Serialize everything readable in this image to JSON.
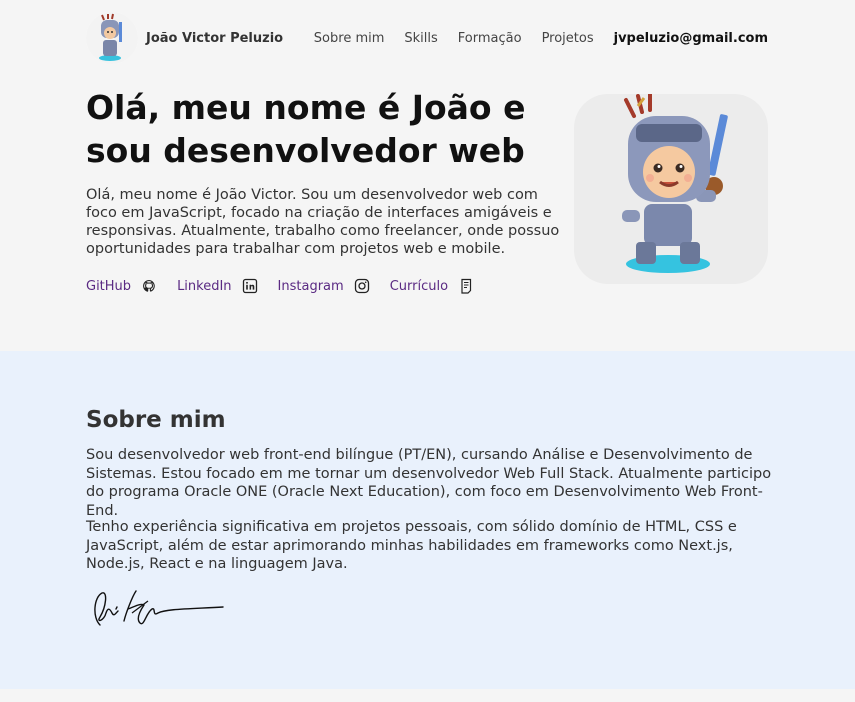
{
  "header": {
    "site_name": "João Victor Peluzio",
    "nav": [
      "Sobre mim",
      "Skills",
      "Formação",
      "Projetos"
    ],
    "email": "jvpeluzio@gmail.com"
  },
  "hero": {
    "title": "Olá, meu nome é João e sou desenvolvedor web",
    "text": "Olá, meu nome é João Victor. Sou um desenvolvedor web com foco em JavaScript, focado na criação de interfaces amigáveis e responsivas. Atualmente, trabalho como freelancer, onde possuo oportunidades para trabalhar com projetos web e mobile.",
    "links": [
      {
        "label": "GitHub",
        "icon": "github-icon"
      },
      {
        "label": "LinkedIn",
        "icon": "linkedin-icon"
      },
      {
        "label": "Instagram",
        "icon": "instagram-icon"
      },
      {
        "label": "Currículo",
        "icon": "document-icon"
      }
    ]
  },
  "about": {
    "title": "Sobre mim",
    "p1": "Sou desenvolvedor web front-end bilíngue (PT/EN), cursando Análise e Desenvolvimento de Sistemas. Estou focado em me tornar um desenvolvedor Web Full Stack. Atualmente participo do programa Oracle ONE (Oracle Next Education), com foco em Desenvolvimento Web Front-End.",
    "p2": "Tenho experiência significativa em projetos pessoais, com sólido domínio de HTML, CSS e JavaScript, além de estar aprimorando minhas habilidades em frameworks como Next.js, Node.js, React e na linguagem Java."
  },
  "colors": {
    "page_bg": "#f5f5f5",
    "about_bg": "#e9f1fc",
    "link": "#5a2a83"
  }
}
